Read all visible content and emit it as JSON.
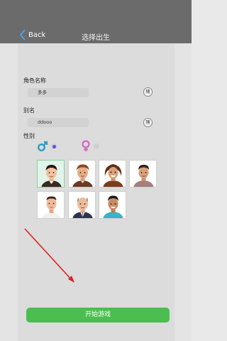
{
  "header": {
    "back_label": "Back",
    "title": "选择出生"
  },
  "form": {
    "role_name_label": "角色名称",
    "role_name_value": "多多",
    "alias_label": "别名",
    "alias_value": "ddooo",
    "random_label": "随",
    "gender_label": "性别",
    "gender_selected": "male"
  },
  "avatars": [
    {
      "id": "avatar-1",
      "selected": true
    },
    {
      "id": "avatar-2",
      "selected": false
    },
    {
      "id": "avatar-3",
      "selected": false
    },
    {
      "id": "avatar-4",
      "selected": false
    },
    {
      "id": "avatar-5",
      "selected": false
    },
    {
      "id": "avatar-6",
      "selected": false
    },
    {
      "id": "avatar-7",
      "selected": false
    }
  ],
  "start_button_label": "开始游戏",
  "colors": {
    "topbar": "#6b6b6b",
    "start_button": "#4bbe4f",
    "male_icon": "#2f9bc4",
    "female_icon": "#d46bc6",
    "radio_selected": "#5a55d6",
    "annotation_arrow": "#e02020"
  },
  "icons": {
    "back": "chevron-left-icon",
    "male": "male-symbol-icon",
    "female": "female-symbol-icon",
    "arrow": "red-arrow-annotation"
  }
}
